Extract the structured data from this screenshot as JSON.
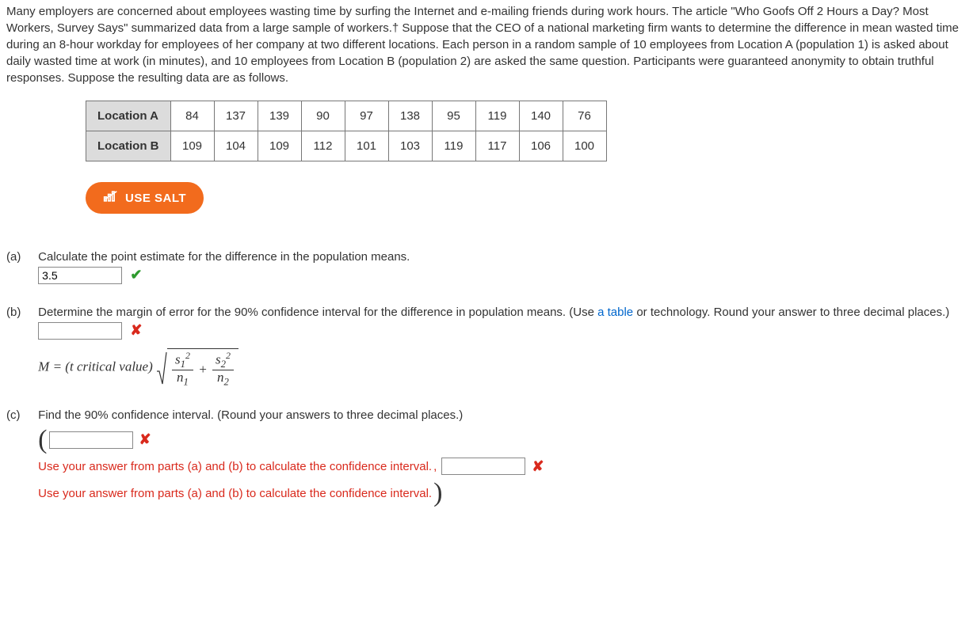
{
  "intro": "Many employers are concerned about employees wasting time by surfing the Internet and e-mailing friends during work hours. The article \"Who Goofs Off 2 Hours a Day? Most Workers, Survey Says\" summarized data from a large sample of workers.† Suppose that the CEO of a national marketing firm wants to determine the difference in mean wasted time during an 8-hour workday for employees of her company at two different locations. Each person in a random sample of 10 employees from Location A (population 1) is asked about daily wasted time at work (in minutes), and 10 employees from Location B (population 2) are asked the same question. Participants were guaranteed anonymity to obtain truthful responses. Suppose the resulting data are as follows.",
  "table": {
    "rowA_label": "Location A",
    "rowB_label": "Location B",
    "A": [
      "84",
      "137",
      "139",
      "90",
      "97",
      "138",
      "95",
      "119",
      "140",
      "76"
    ],
    "B": [
      "109",
      "104",
      "109",
      "112",
      "101",
      "103",
      "119",
      "117",
      "106",
      "100"
    ]
  },
  "salt_label": "USE SALT",
  "parts": {
    "a": {
      "label": "(a)",
      "prompt": "Calculate the point estimate for the difference in the population means.",
      "value": "3.5"
    },
    "b": {
      "label": "(b)",
      "prompt_pre": "Determine the margin of error for the 90% confidence interval for the difference in population means. (Use ",
      "link": "a table",
      "prompt_post": " or technology. Round your answer to three decimal places.)",
      "value": "",
      "formula_lhs": "M = (t critical value)",
      "s1": "s",
      "s2": "s",
      "n1": "n",
      "n2": "n"
    },
    "c": {
      "label": "(c)",
      "prompt": "Find the 90% confidence interval. (Round your answers to three decimal places.)",
      "value1": "",
      "value2": "",
      "hint1": "Use your answer from parts (a) and (b) to calculate the confidence interval.",
      "hint2": "Use your answer from parts (a) and (b) to calculate the confidence interval."
    }
  }
}
